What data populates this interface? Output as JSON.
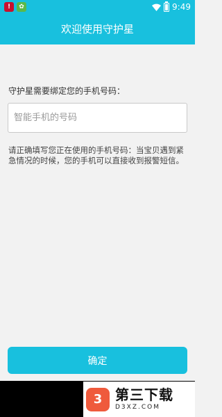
{
  "status_bar": {
    "time": "9:49",
    "notification_icons": [
      "app-notification-icon",
      "game-notification-icon"
    ],
    "system_icons": [
      "wifi-icon",
      "battery-icon"
    ]
  },
  "app_bar": {
    "title": "欢迎使用守护星"
  },
  "form": {
    "prompt": "守护星需要绑定您的手机号码：",
    "phone_input": {
      "value": "",
      "placeholder": "智能手机的号码"
    },
    "help_text": "请正确填写您正在使用的手机号码：当宝贝遇到紧急情况的时候，您的手机可以直接收到报警短信。"
  },
  "confirm_button": {
    "label": "确定"
  },
  "watermark": {
    "name": "第三下载",
    "domain": "D3XZ.COM"
  },
  "colors": {
    "accent": "#18c0de",
    "background": "#f2f2f2",
    "text": "#333333"
  }
}
